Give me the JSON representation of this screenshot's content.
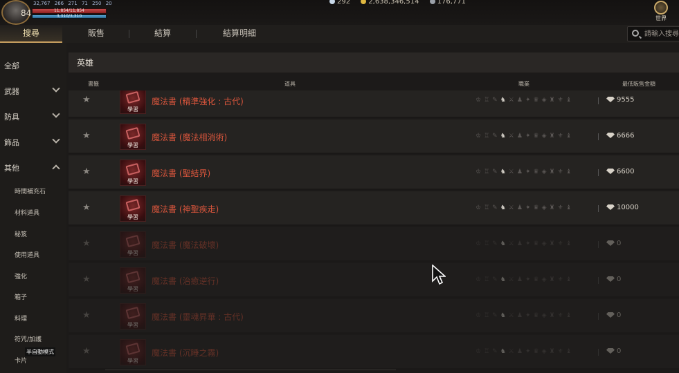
{
  "hud": {
    "level": "84",
    "stats": [
      "32,767",
      "266",
      "271",
      "71",
      "250",
      "20"
    ],
    "hp_text": "11,854/11,854",
    "mp_text": "3,310/3,310",
    "hp_fraction": 1.0,
    "mp_fraction": 1.0,
    "currency": {
      "diamonds": "292",
      "gold": "2,638,346,514",
      "silver": "176,771"
    },
    "world_label": "世界"
  },
  "tabs": [
    {
      "label": "搜尋",
      "active": true
    },
    {
      "label": "販售",
      "active": false
    },
    {
      "label": "結算",
      "active": false
    },
    {
      "label": "結算明細",
      "active": false
    }
  ],
  "search": {
    "placeholder": "請輸入搜尋"
  },
  "sidebar": {
    "categories": [
      {
        "label": "全部",
        "expandable": false
      },
      {
        "label": "武器",
        "expandable": true,
        "expanded": false
      },
      {
        "label": "防具",
        "expandable": true,
        "expanded": false
      },
      {
        "label": "飾品",
        "expandable": true,
        "expanded": false
      },
      {
        "label": "其他",
        "expandable": true,
        "expanded": true
      }
    ],
    "subitems": [
      "時間補充石",
      "材料道具",
      "秘笈",
      "使用道具",
      "強化",
      "箱子",
      "料理",
      "符咒/加護",
      "卡片"
    ],
    "auto_mode": "半自動模式"
  },
  "main": {
    "category_title": "英雄",
    "columns": {
      "fav": "書籤",
      "item": "道具",
      "class": "職業",
      "min_price": "最低販售金額"
    },
    "rows": [
      {
        "name": "魔法書 (精準強化 : 古代)",
        "badge": "學習",
        "price": "9555",
        "dim": false
      },
      {
        "name": "魔法書 (魔法相消術)",
        "badge": "學習",
        "price": "6666",
        "dim": false
      },
      {
        "name": "魔法書 (聖結界)",
        "badge": "學習",
        "price": "6600",
        "dim": false
      },
      {
        "name": "魔法書 (神聖疾走)",
        "badge": "學習",
        "price": "10000",
        "dim": false
      },
      {
        "name": "魔法書 (魔法破壞)",
        "badge": "學習",
        "price": "0",
        "dim": true
      },
      {
        "name": "魔法書 (治癒逆行)",
        "badge": "學習",
        "price": "0",
        "dim": true
      },
      {
        "name": "魔法書 (靈魂昇華 : 古代)",
        "badge": "學習",
        "price": "0",
        "dim": true
      },
      {
        "name": "魔法書 (沉睡之霧)",
        "badge": "學習",
        "price": "0",
        "dim": true
      }
    ]
  },
  "colors": {
    "accent": "#c8a060",
    "item_name": "#d8553c",
    "background": "#1c1a19"
  }
}
